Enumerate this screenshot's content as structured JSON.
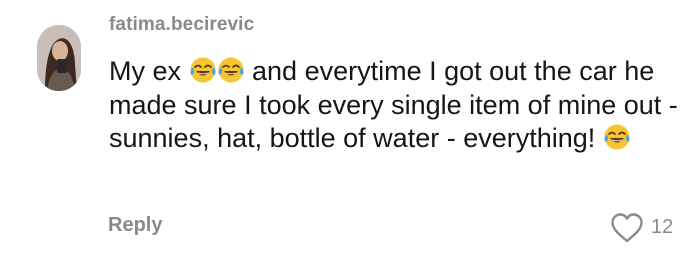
{
  "comment": {
    "username": "fatima.becirevic",
    "text_parts": {
      "p1": "My ex ",
      "p2": " and everytime I got out the car he made sure I took every single item of mine out - sunnies, hat, bottle of water - everything! "
    },
    "emoji_names": [
      "face-with-tears-of-joy",
      "face-with-tears-of-joy",
      "face-with-tears-of-joy"
    ],
    "reply_label": "Reply",
    "like_count": "12"
  },
  "colors": {
    "username": "#8a8a8a",
    "text": "#161616",
    "meta": "#8a8a8a",
    "emoji_face": "#f7c531",
    "emoji_tear": "#4aa3df"
  }
}
